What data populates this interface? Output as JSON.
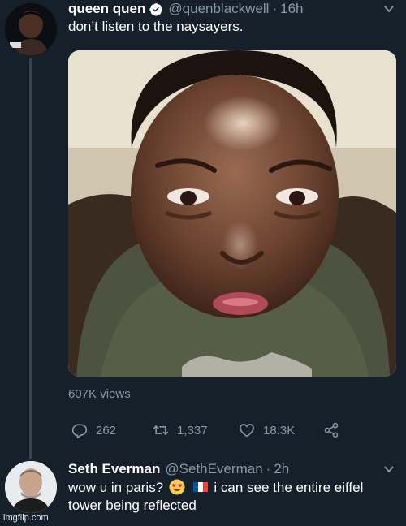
{
  "colors": {
    "background": "#15202b",
    "secondary_text": "#8899a6",
    "verified_blue": "#1da1f2",
    "thread_line": "#38444d"
  },
  "tweet1": {
    "display_name": "queen quen",
    "verified_icon": "verified-badge-icon",
    "handle": "@quenblackwell",
    "separator": "·",
    "time": "16h",
    "text": "don’t listen to the naysayers.",
    "views": "607K views",
    "actions": {
      "reply_icon": "reply-icon",
      "reply_count": "262",
      "retweet_icon": "retweet-icon",
      "retweet_count": "1,337",
      "like_icon": "heart-icon",
      "like_count": "18.3K",
      "share_icon": "share-icon"
    }
  },
  "tweet2": {
    "display_name": "Seth Everman",
    "handle": "@SethEverman",
    "separator": "·",
    "time": "2h",
    "text_part1": "wow u in paris?",
    "emoji1": "heart-eyes-emoji",
    "emoji2": "french-flag-emoji",
    "text_part2": "i can see the entire eiffel tower being reflected"
  },
  "watermark": "imgflip.com"
}
